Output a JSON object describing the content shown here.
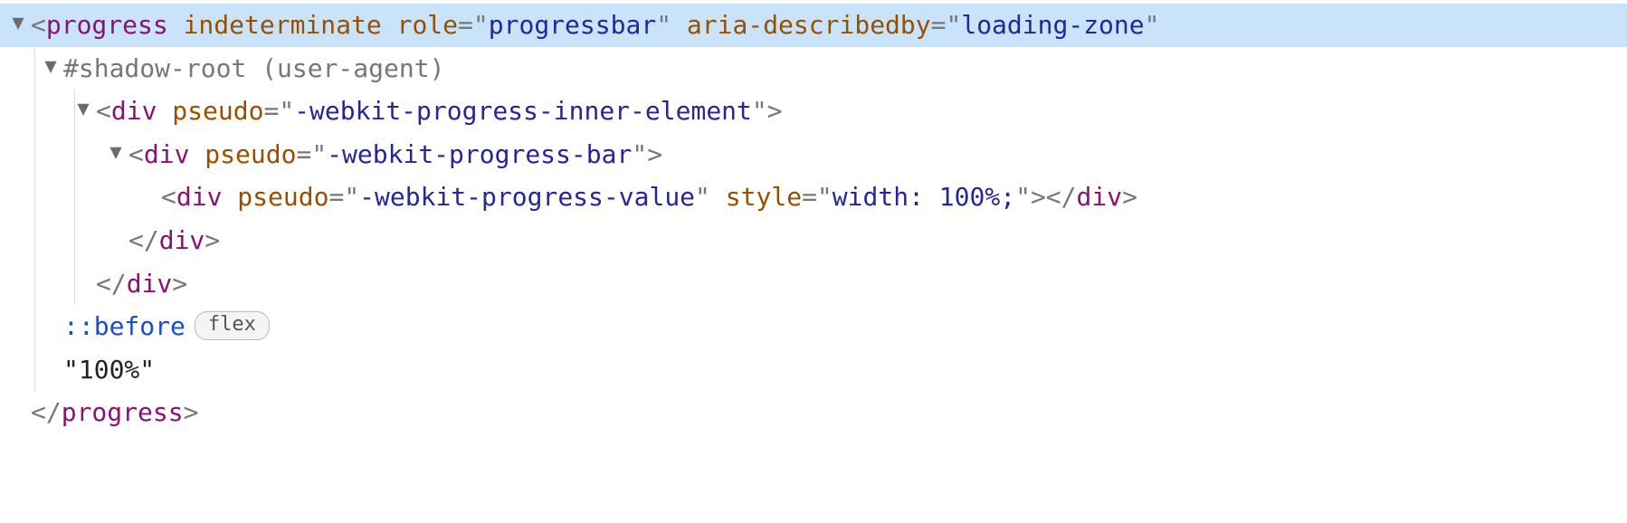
{
  "glyphs": {
    "expanded": "▼",
    "lt": "<",
    "gt": ">",
    "lt_slash": "</",
    "eq": "=",
    "dq": "\""
  },
  "lines": {
    "l0": {
      "tag": "progress",
      "attrs": [
        {
          "name": "indeterminate",
          "value": null
        },
        {
          "name": "role",
          "value": "progressbar"
        },
        {
          "name": "aria-describedby",
          "value": "loading-zone"
        }
      ]
    },
    "l1": {
      "text": "#shadow-root (user-agent)"
    },
    "l2": {
      "tag": "div",
      "attrs": [
        {
          "name": "pseudo",
          "value": "-webkit-progress-inner-element"
        }
      ]
    },
    "l3": {
      "tag": "div",
      "attrs": [
        {
          "name": "pseudo",
          "value": "-webkit-progress-bar"
        }
      ]
    },
    "l4": {
      "tag": "div",
      "attrs": [
        {
          "name": "pseudo",
          "value": "-webkit-progress-value"
        },
        {
          "name": "style",
          "value": "width: 100%;"
        }
      ],
      "close_tag": "div"
    },
    "l5": {
      "close_tag": "div"
    },
    "l6": {
      "close_tag": "div"
    },
    "l7": {
      "pseudo": "::before",
      "badge": "flex"
    },
    "l8": {
      "text_node": "\"100%\""
    },
    "l9": {
      "close_tag": "progress"
    }
  }
}
